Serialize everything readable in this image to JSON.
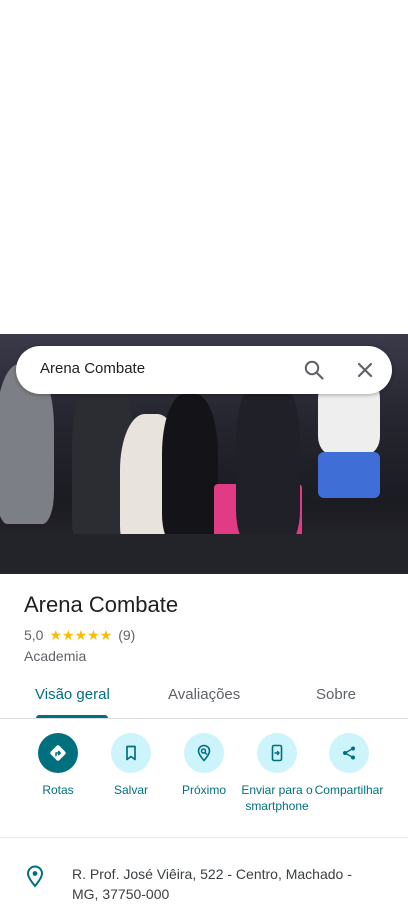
{
  "search": {
    "query": "Arena Combate"
  },
  "place": {
    "title": "Arena Combate",
    "rating": "5,0",
    "stars": "★★★★★",
    "review_count": "(9)",
    "category": "Academia"
  },
  "tabs": [
    {
      "label": "Visão geral"
    },
    {
      "label": "Avaliações"
    },
    {
      "label": "Sobre"
    }
  ],
  "actions": [
    {
      "label": "Rotas",
      "icon": "directions-icon"
    },
    {
      "label": "Salvar",
      "icon": "bookmark-icon"
    },
    {
      "label": "Próximo",
      "icon": "nearby-icon"
    },
    {
      "label": "Enviar para o smartphone",
      "icon": "send-to-phone-icon"
    },
    {
      "label": "Compartilhar",
      "icon": "share-icon"
    }
  ],
  "address": {
    "text": "R. Prof. José Viêira, 522 - Centro, Machado - MG, 37750-000"
  },
  "colors": {
    "accent": "#00707e",
    "action_bg": "#cdf3fb",
    "star": "#fbbc04"
  }
}
